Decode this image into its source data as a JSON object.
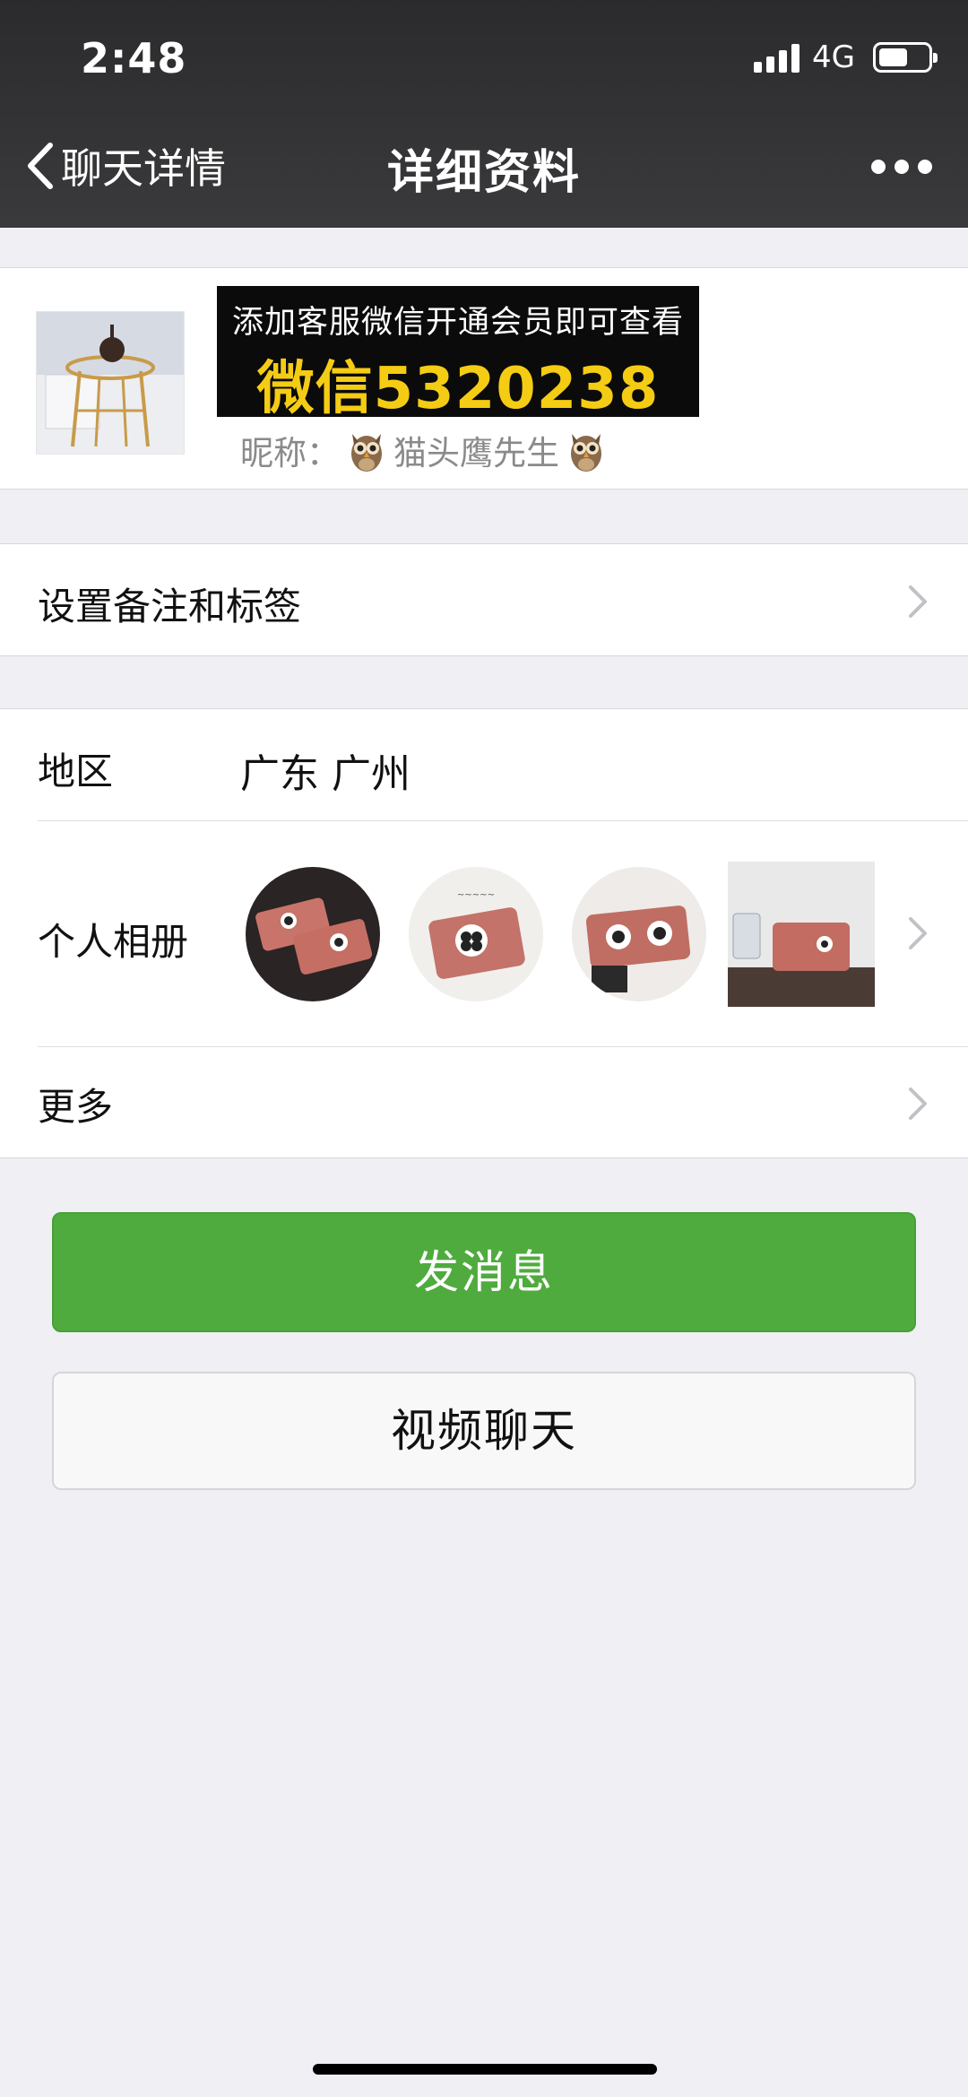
{
  "status_bar": {
    "time": "2:48",
    "network": "4G",
    "battery_level": 0.6
  },
  "nav": {
    "back_label": "聊天详情",
    "title": "详细资料"
  },
  "profile": {
    "banner_line1": "添加客服微信开通会员即可查看",
    "banner_line2": "微信5320238",
    "nickname_label": "昵称：",
    "nickname": "猫头鹰先生"
  },
  "rows": {
    "remark": "设置备注和标签",
    "region_label": "地区",
    "region_value": "广东 广州",
    "album_label": "个人相册",
    "more_label": "更多"
  },
  "buttons": {
    "send": "发消息",
    "video": "视频聊天"
  },
  "colors": {
    "accent_green": "#4fab3e",
    "banner_yellow": "#f4cc14",
    "nav_bg": "#333335"
  }
}
